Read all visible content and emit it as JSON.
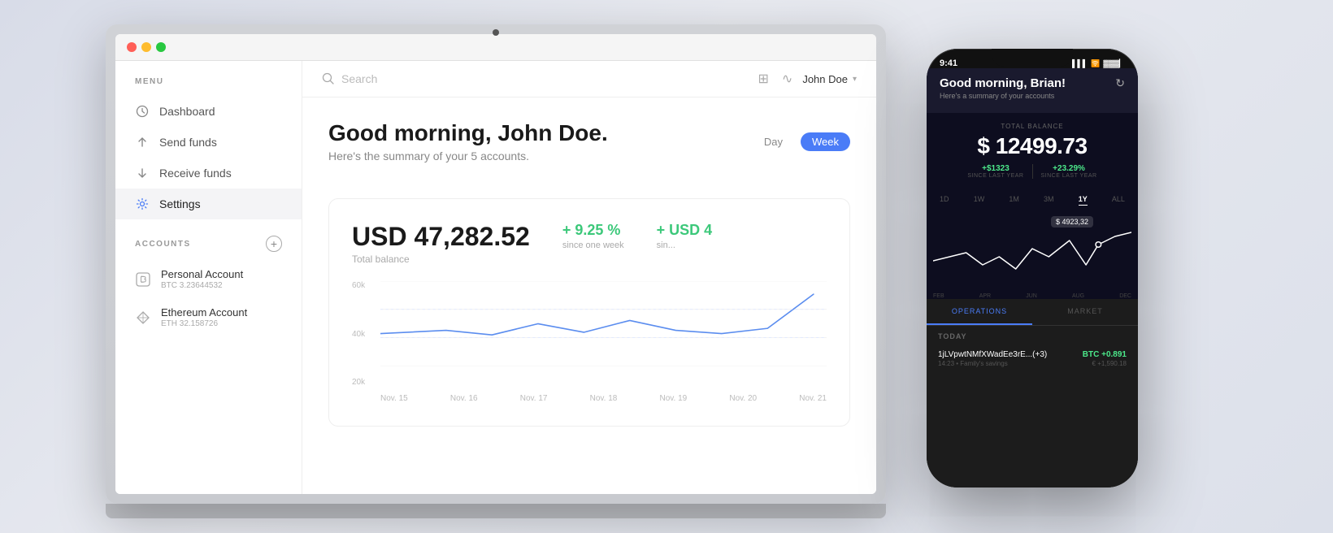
{
  "background": {
    "color_start": "#d8dce8",
    "color_end": "#dce0ea"
  },
  "laptop": {
    "traffic_lights": [
      "red",
      "yellow",
      "green"
    ],
    "search_placeholder": "Search",
    "top_bar_icons": [
      "clipboard-icon",
      "activity-icon"
    ],
    "user": "John Doe",
    "menu_label": "MENU",
    "nav_items": [
      {
        "label": "Dashboard",
        "icon": "clock"
      },
      {
        "label": "Send funds",
        "icon": "arrow-up"
      },
      {
        "label": "Receive funds",
        "icon": "arrow-down"
      },
      {
        "label": "Settings",
        "icon": "gear",
        "active": true
      }
    ],
    "accounts_label": "ACCOUNTS",
    "accounts": [
      {
        "name": "Personal Account",
        "sub": "BTC 3.23644532",
        "icon": "bitcoin"
      },
      {
        "name": "Ethereum Account",
        "sub": "ETH 32.158726",
        "icon": "diamond"
      }
    ],
    "greeting": "Good morning, John Doe.",
    "greeting_sub": "Here's the summary of your 5 accounts.",
    "period_tabs": [
      {
        "label": "Day"
      },
      {
        "label": "Week",
        "active": true
      }
    ],
    "chart": {
      "total_balance_value": "USD 47,282.52",
      "total_balance_label": "Total balance",
      "change_pct": "+ 9.25 %",
      "change_pct_label": "since one week",
      "change_val": "+ USD 4",
      "change_val_label": "sin...",
      "y_labels": [
        "60k",
        "40k",
        "20k"
      ],
      "x_labels": [
        "Nov. 15",
        "Nov. 16",
        "Nov. 17",
        "Nov. 18",
        "Nov. 19",
        "Nov. 20",
        "Nov. 21"
      ]
    }
  },
  "phone": {
    "status_time": "9:41",
    "refresh_icon": "refresh",
    "greeting": "Good morning, Brian!",
    "greeting_sub": "Here's a summary of your accounts",
    "balance_label": "TOTAL BALANCE",
    "balance_value": "$ 12499.73",
    "changes": [
      {
        "value": "+$1323",
        "label": "SINCE LAST YEAR"
      },
      {
        "value": "+23.29%",
        "label": "SINCE LAST YEAR"
      }
    ],
    "period_tabs": [
      "1D",
      "1W",
      "1M",
      "3M",
      "1Y",
      "ALL"
    ],
    "active_period": "1Y",
    "chart_tooltip": "$ 4923,32",
    "x_labels": [
      "FEB",
      "APR",
      "JUN",
      "AUG",
      "DEC"
    ],
    "bottom_tabs": [
      "OPERATIONS",
      "MARKET"
    ],
    "active_bottom_tab": "OPERATIONS",
    "today_label": "TODAY",
    "transaction": {
      "address": "1jLVpwtNMfXWadEe3rE...(+3)",
      "meta": "14:23 • Family's savings",
      "currency": "BTC",
      "amount": "+0.891",
      "fiat": "€ +1,590.18"
    }
  }
}
